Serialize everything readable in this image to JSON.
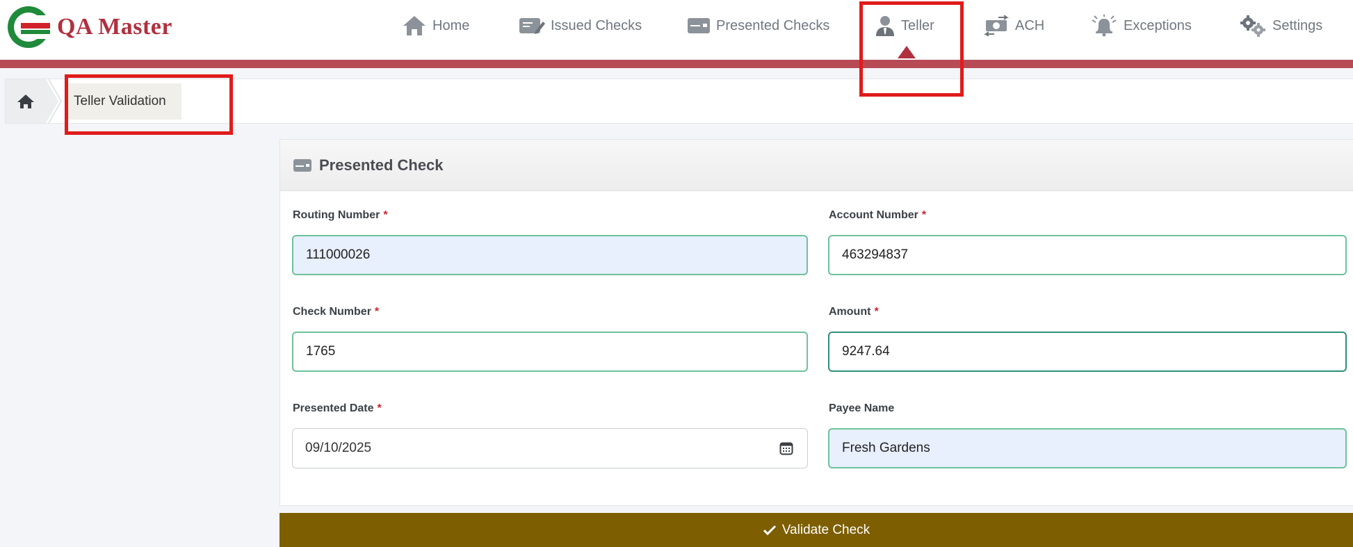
{
  "app": {
    "brand_name": "QA Master"
  },
  "nav": {
    "items": [
      {
        "label": "Home",
        "icon": "home-icon"
      },
      {
        "label": "Issued Checks",
        "icon": "edit-check-icon"
      },
      {
        "label": "Presented Checks",
        "icon": "check-card-icon"
      },
      {
        "label": "Teller",
        "icon": "teller-user-icon",
        "active": true
      },
      {
        "label": "ACH",
        "icon": "transfer-icon"
      },
      {
        "label": "Exceptions",
        "icon": "alert-bell-icon"
      },
      {
        "label": "Settings",
        "icon": "gears-icon"
      }
    ]
  },
  "breadcrumb": {
    "current": "Teller Validation"
  },
  "panel": {
    "title": "Presented Check",
    "fields": {
      "routing": {
        "label": "Routing Number",
        "required": "*",
        "value": "111000026"
      },
      "account": {
        "label": "Account Number",
        "required": "*",
        "value": "463294837"
      },
      "check": {
        "label": "Check Number",
        "required": "*",
        "value": "1765"
      },
      "amount": {
        "label": "Amount",
        "required": "*",
        "value": "9247.64"
      },
      "date": {
        "label": "Presented Date",
        "required": "*",
        "value": "09/10/2025"
      },
      "payee": {
        "label": "Payee Name",
        "value": "Fresh Gardens"
      }
    }
  },
  "actions": {
    "validate_label": "Validate Check"
  },
  "colors": {
    "brand": "#b0303e",
    "accent_bar": "#b84a56",
    "button": "#7d5e00",
    "field_border": "#6cc29b",
    "annotation": "#e01b1b"
  }
}
